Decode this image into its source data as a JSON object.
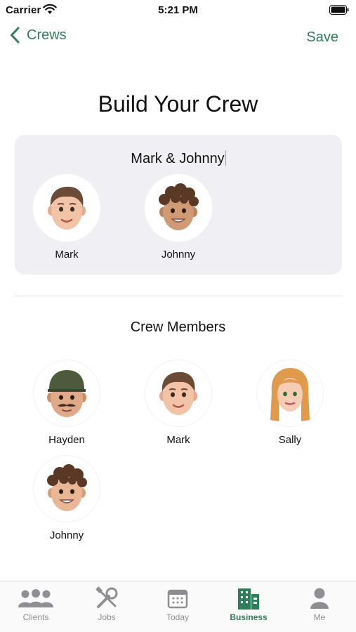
{
  "status_bar": {
    "carrier": "Carrier",
    "time": "5:21 PM"
  },
  "nav": {
    "back_label": "Crews",
    "save_label": "Save"
  },
  "page_title": "Build Your Crew",
  "crew": {
    "name": "Mark & Johnny",
    "selected": [
      {
        "name": "Mark"
      },
      {
        "name": "Johnny"
      }
    ]
  },
  "members_title": "Crew Members",
  "members": [
    {
      "name": "Hayden"
    },
    {
      "name": "Mark"
    },
    {
      "name": "Sally"
    },
    {
      "name": "Johnny"
    }
  ],
  "tabs": [
    {
      "label": "Clients",
      "icon": "people-icon"
    },
    {
      "label": "Jobs",
      "icon": "tools-icon"
    },
    {
      "label": "Today",
      "icon": "calendar-icon"
    },
    {
      "label": "Business",
      "icon": "building-icon",
      "active": true
    },
    {
      "label": "Me",
      "icon": "person-icon"
    }
  ],
  "colors": {
    "accent": "#2e7d5b",
    "card": "#f0f0f4",
    "inactive": "#8e8e93"
  }
}
